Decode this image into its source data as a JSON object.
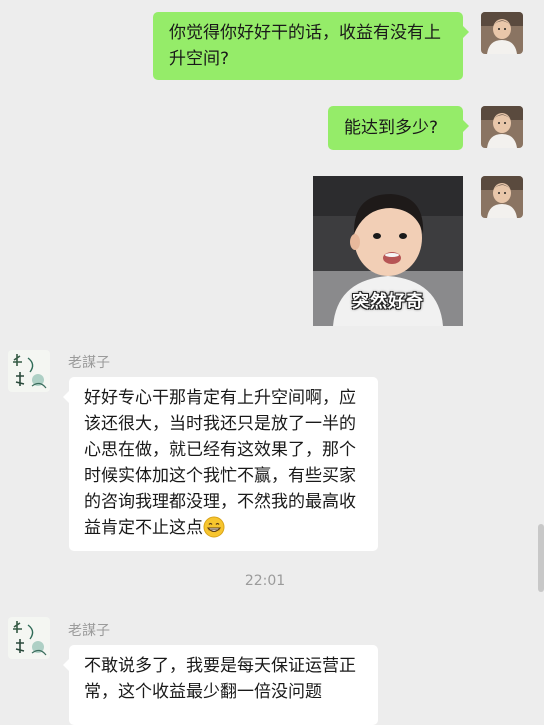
{
  "messages": {
    "m1": {
      "text": "你觉得你好好干的话，收益有没有上升空间?"
    },
    "m2": {
      "text": "能达到多少?"
    },
    "sticker": {
      "caption": "突然好奇"
    },
    "m3": {
      "sender": "老謀子",
      "text": "好好专心干那肯定有上升空间啊，应该还很大，当时我还只是放了一半的心思在做，就已经有这效果了，那个时候实体加这个我忙不赢，有些买家的咨询我理都没理，不然我的最高收益肯定不止这点",
      "emoji": "grinning-face-icon"
    },
    "time_divider": "22:01",
    "m4": {
      "sender": "老謀子",
      "text": "不敢说多了，我要是每天保证运营正常，这个收益最少翻一倍没问题"
    }
  },
  "colors": {
    "background": "#ededed",
    "self_bubble": "#95ec69",
    "other_bubble": "#ffffff",
    "meta_text": "#9b9b9b"
  },
  "icons": {
    "self_avatar": "toddler-photo-avatar",
    "other_avatar": "ink-painting-avatar"
  }
}
